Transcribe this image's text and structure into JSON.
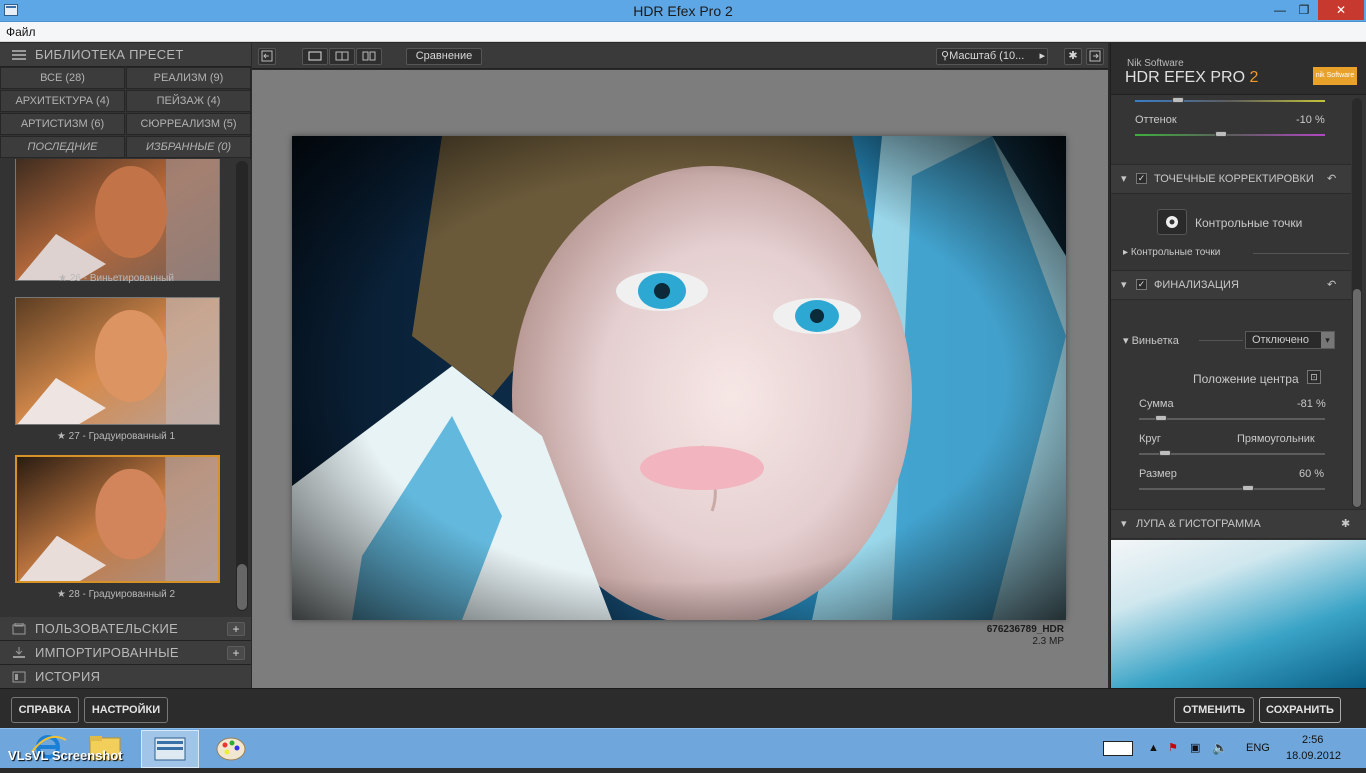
{
  "window": {
    "title": "HDR Efex Pro 2",
    "minimize": "—",
    "maximize": "❐",
    "close": "✕"
  },
  "menu": {
    "file": "Файл"
  },
  "left_panel": {
    "library_title": "БИБЛИОТЕКА ПРЕСЕТ",
    "filters": [
      {
        "label": "ВСЕ (28)"
      },
      {
        "label": "РЕАЛИЗМ (9)"
      },
      {
        "label": "АРХИТЕКТУРА (4)"
      },
      {
        "label": "ПЕЙЗАЖ (4)"
      },
      {
        "label": "АРТИСТИЗМ (6)"
      },
      {
        "label": "СЮРРЕАЛИЗМ (5)"
      },
      {
        "label": "ПОСЛЕДНИЕ"
      },
      {
        "label": "ИЗБРАННЫЕ (0)"
      }
    ],
    "presets": [
      {
        "caption": "★ 26 - Виньетированный"
      },
      {
        "caption": "★ 27 - Градуированный 1"
      },
      {
        "caption": "★ 28 - Градуированный 2"
      }
    ],
    "sections": {
      "custom": "ПОЛЬЗОВАТЕЛЬСКИЕ",
      "imported": "ИМПОРТИРОВАННЫЕ",
      "history": "ИСТОРИЯ",
      "plus": "+"
    }
  },
  "toolbar": {
    "compare": "Сравнение",
    "zoom": "Масштаб (10..."
  },
  "image": {
    "filename": "676236789_HDR",
    "size": "2.3 MP"
  },
  "right_panel": {
    "brand_small": "Nik Software",
    "brand_title": "HDR EFEX PRO",
    "brand_version": "2",
    "brand_logo": "nik Software",
    "tint_label": "Оттенок",
    "tint_value": "-10 %",
    "point_corrections": "ТОЧЕЧНЫЕ КОРРЕКТИРОВКИ",
    "control_points_button": "Контрольные точки",
    "control_points_list": "Контрольные точки",
    "finalization": "ФИНАЛИЗАЦИЯ",
    "vignette_label": "Виньетка",
    "vignette_value": "Отключено",
    "center_position": "Положение центра",
    "amount_label": "Сумма",
    "amount_value": "-81 %",
    "circle_label": "Круг",
    "rect_label": "Прямоугольник",
    "size_label": "Размер",
    "size_value": "60 %",
    "loupe": "ЛУПА & ГИСТОГРАММА",
    "check": "✓"
  },
  "bottom": {
    "help": "СПРАВКА",
    "settings": "НАСТРОЙКИ",
    "cancel": "ОТМЕНИТЬ",
    "save": "СОХРАНИТЬ"
  },
  "taskbar": {
    "watermark": "VLsVL Screenshot",
    "lang": "ENG",
    "time": "2:56",
    "date": "18.09.2012"
  }
}
